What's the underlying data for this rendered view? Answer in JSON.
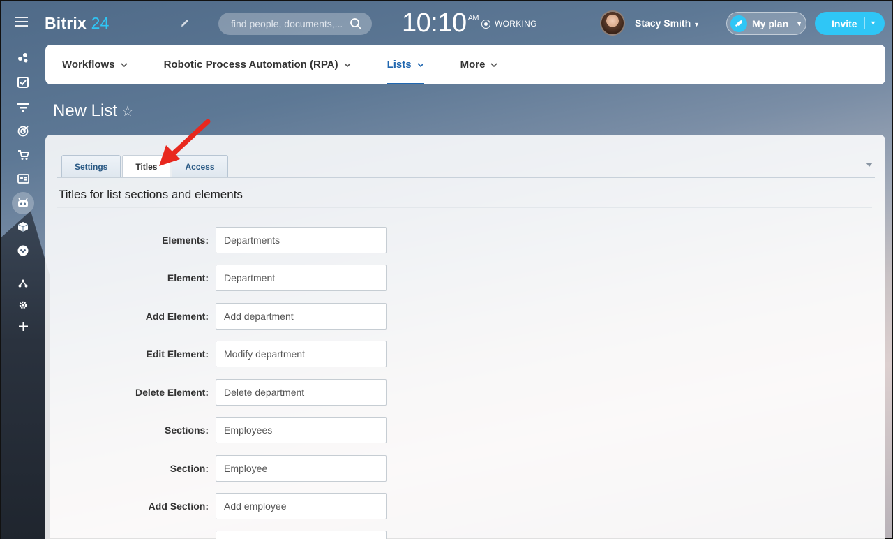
{
  "header": {
    "logo_text": "Bitrix",
    "logo_number": "24",
    "search_placeholder": "find people, documents,...",
    "time": "10:10",
    "time_suffix": "AM",
    "status": "WORKING",
    "user_name": "Stacy Smith",
    "plan_label": "My plan",
    "invite_label": "Invite"
  },
  "sidebar": {
    "icons": [
      "activity-stream-icon",
      "tasks-icon",
      "filter-icon",
      "target-icon",
      "cart-icon",
      "contact-card-icon",
      "robot-icon",
      "box-icon",
      "chevron-circle-icon",
      "network-icon",
      "gear-icon",
      "plus-icon"
    ]
  },
  "nav": {
    "items": [
      {
        "label": "Workflows",
        "active": false
      },
      {
        "label": "Robotic Process Automation (RPA)",
        "active": false
      },
      {
        "label": "Lists",
        "active": true
      },
      {
        "label": "More",
        "active": false
      }
    ]
  },
  "page": {
    "title": "New List"
  },
  "tabs": [
    {
      "label": "Settings",
      "active": false
    },
    {
      "label": "Titles",
      "active": true
    },
    {
      "label": "Access",
      "active": false
    }
  ],
  "section_title": "Titles for list sections and elements",
  "fields": [
    {
      "label": "Elements:",
      "value": "Departments"
    },
    {
      "label": "Element:",
      "value": "Department"
    },
    {
      "label": "Add Element:",
      "value": "Add department"
    },
    {
      "label": "Edit Element:",
      "value": "Modify department"
    },
    {
      "label": "Delete Element:",
      "value": "Delete department"
    },
    {
      "label": "Sections:",
      "value": "Employees"
    },
    {
      "label": "Section:",
      "value": "Employee"
    },
    {
      "label": "Add Section:",
      "value": "Add employee"
    },
    {
      "label": "",
      "value": ""
    }
  ],
  "colors": {
    "accent": "#2fc6f6",
    "nav_active": "#2067b0",
    "annotation_arrow": "#e8281e"
  }
}
